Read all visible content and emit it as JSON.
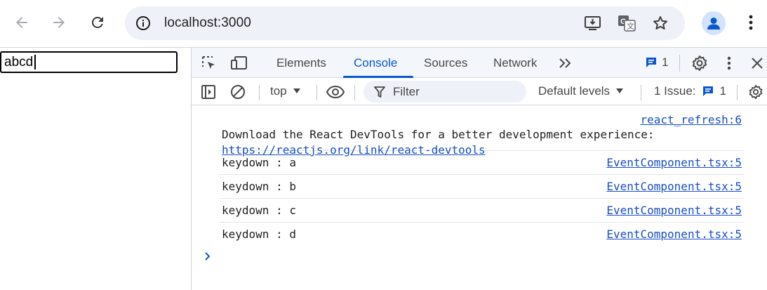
{
  "browser": {
    "url": "localhost:3000"
  },
  "page": {
    "input_value": "abcd"
  },
  "devtools": {
    "tabs": [
      {
        "label": "Elements"
      },
      {
        "label": "Console"
      },
      {
        "label": "Sources"
      },
      {
        "label": "Network"
      }
    ],
    "active_tab": "Console",
    "message_count": "1",
    "console_bar": {
      "context": "top",
      "filter_placeholder": "Filter",
      "levels": "Default levels",
      "issues_label": "1 Issue:",
      "issues_count": "1"
    },
    "console": {
      "first_message": {
        "source": "react_refresh:6",
        "text": "Download the React DevTools for a better development experience:",
        "link": "https://reactjs.org/link/react-devtools"
      },
      "logs": [
        {
          "text": "keydown : a",
          "source": "EventComponent.tsx:5"
        },
        {
          "text": "keydown : b",
          "source": "EventComponent.tsx:5"
        },
        {
          "text": "keydown : c",
          "source": "EventComponent.tsx:5"
        },
        {
          "text": "keydown : d",
          "source": "EventComponent.tsx:5"
        }
      ]
    }
  },
  "colors": {
    "accent": "#0b57d0",
    "link": "#1a4fc4",
    "omnibox_bg": "#eef1f8",
    "devtools_header_bg": "#f3f6fb"
  }
}
